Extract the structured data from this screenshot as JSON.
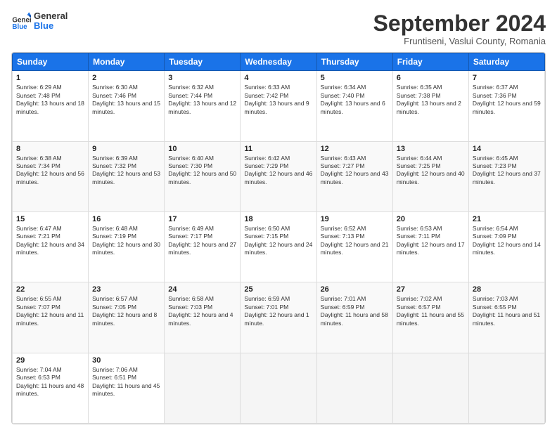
{
  "header": {
    "logo_line1": "General",
    "logo_line2": "Blue",
    "month": "September 2024",
    "location": "Fruntiseni, Vaslui County, Romania"
  },
  "days_of_week": [
    "Sunday",
    "Monday",
    "Tuesday",
    "Wednesday",
    "Thursday",
    "Friday",
    "Saturday"
  ],
  "weeks": [
    [
      {
        "day": "1",
        "sunrise": "6:29 AM",
        "sunset": "7:48 PM",
        "daylight": "13 hours and 18 minutes."
      },
      {
        "day": "2",
        "sunrise": "6:30 AM",
        "sunset": "7:46 PM",
        "daylight": "13 hours and 15 minutes."
      },
      {
        "day": "3",
        "sunrise": "6:32 AM",
        "sunset": "7:44 PM",
        "daylight": "13 hours and 12 minutes."
      },
      {
        "day": "4",
        "sunrise": "6:33 AM",
        "sunset": "7:42 PM",
        "daylight": "13 hours and 9 minutes."
      },
      {
        "day": "5",
        "sunrise": "6:34 AM",
        "sunset": "7:40 PM",
        "daylight": "13 hours and 6 minutes."
      },
      {
        "day": "6",
        "sunrise": "6:35 AM",
        "sunset": "7:38 PM",
        "daylight": "13 hours and 2 minutes."
      },
      {
        "day": "7",
        "sunrise": "6:37 AM",
        "sunset": "7:36 PM",
        "daylight": "12 hours and 59 minutes."
      }
    ],
    [
      {
        "day": "8",
        "sunrise": "6:38 AM",
        "sunset": "7:34 PM",
        "daylight": "12 hours and 56 minutes."
      },
      {
        "day": "9",
        "sunrise": "6:39 AM",
        "sunset": "7:32 PM",
        "daylight": "12 hours and 53 minutes."
      },
      {
        "day": "10",
        "sunrise": "6:40 AM",
        "sunset": "7:30 PM",
        "daylight": "12 hours and 50 minutes."
      },
      {
        "day": "11",
        "sunrise": "6:42 AM",
        "sunset": "7:29 PM",
        "daylight": "12 hours and 46 minutes."
      },
      {
        "day": "12",
        "sunrise": "6:43 AM",
        "sunset": "7:27 PM",
        "daylight": "12 hours and 43 minutes."
      },
      {
        "day": "13",
        "sunrise": "6:44 AM",
        "sunset": "7:25 PM",
        "daylight": "12 hours and 40 minutes."
      },
      {
        "day": "14",
        "sunrise": "6:45 AM",
        "sunset": "7:23 PM",
        "daylight": "12 hours and 37 minutes."
      }
    ],
    [
      {
        "day": "15",
        "sunrise": "6:47 AM",
        "sunset": "7:21 PM",
        "daylight": "12 hours and 34 minutes."
      },
      {
        "day": "16",
        "sunrise": "6:48 AM",
        "sunset": "7:19 PM",
        "daylight": "12 hours and 30 minutes."
      },
      {
        "day": "17",
        "sunrise": "6:49 AM",
        "sunset": "7:17 PM",
        "daylight": "12 hours and 27 minutes."
      },
      {
        "day": "18",
        "sunrise": "6:50 AM",
        "sunset": "7:15 PM",
        "daylight": "12 hours and 24 minutes."
      },
      {
        "day": "19",
        "sunrise": "6:52 AM",
        "sunset": "7:13 PM",
        "daylight": "12 hours and 21 minutes."
      },
      {
        "day": "20",
        "sunrise": "6:53 AM",
        "sunset": "7:11 PM",
        "daylight": "12 hours and 17 minutes."
      },
      {
        "day": "21",
        "sunrise": "6:54 AM",
        "sunset": "7:09 PM",
        "daylight": "12 hours and 14 minutes."
      }
    ],
    [
      {
        "day": "22",
        "sunrise": "6:55 AM",
        "sunset": "7:07 PM",
        "daylight": "12 hours and 11 minutes."
      },
      {
        "day": "23",
        "sunrise": "6:57 AM",
        "sunset": "7:05 PM",
        "daylight": "12 hours and 8 minutes."
      },
      {
        "day": "24",
        "sunrise": "6:58 AM",
        "sunset": "7:03 PM",
        "daylight": "12 hours and 4 minutes."
      },
      {
        "day": "25",
        "sunrise": "6:59 AM",
        "sunset": "7:01 PM",
        "daylight": "12 hours and 1 minute."
      },
      {
        "day": "26",
        "sunrise": "7:01 AM",
        "sunset": "6:59 PM",
        "daylight": "11 hours and 58 minutes."
      },
      {
        "day": "27",
        "sunrise": "7:02 AM",
        "sunset": "6:57 PM",
        "daylight": "11 hours and 55 minutes."
      },
      {
        "day": "28",
        "sunrise": "7:03 AM",
        "sunset": "6:55 PM",
        "daylight": "11 hours and 51 minutes."
      }
    ],
    [
      {
        "day": "29",
        "sunrise": "7:04 AM",
        "sunset": "6:53 PM",
        "daylight": "11 hours and 48 minutes."
      },
      {
        "day": "30",
        "sunrise": "7:06 AM",
        "sunset": "6:51 PM",
        "daylight": "11 hours and 45 minutes."
      },
      null,
      null,
      null,
      null,
      null
    ]
  ]
}
